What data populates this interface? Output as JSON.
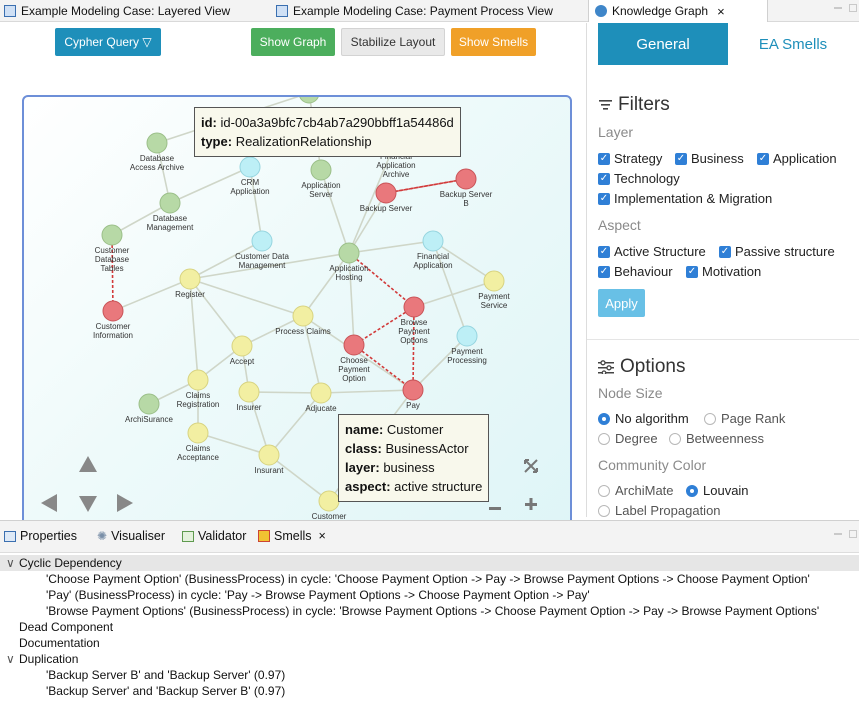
{
  "tabs": {
    "layered_view": "Example Modeling Case: Layered View",
    "payment_view": "Example Modeling Case: Payment Process View",
    "knowledge_graph": "Knowledge Graph",
    "close_glyph": "×"
  },
  "toolbar": {
    "cypher_query": "Cypher Query ▽",
    "show_graph": "Show Graph",
    "stabilize_layout": "Stabilize Layout",
    "show_smells": "Show Smells"
  },
  "colors": {
    "cypher": "#1e8fba",
    "show_graph": "#4cae5d",
    "stabilize": "#e9e9e9",
    "show_smells": "#f0a028",
    "general_tab": "#1e8fba",
    "apply": "#68c0e6",
    "node_green": "#b7d9a6",
    "node_cyan": "#bdeff6",
    "node_yellow": "#f2efa2",
    "node_red": "#e9787c"
  },
  "graph": {
    "tooltip_top": {
      "id_key": "id:",
      "id_value": "id-00a3a9bfc7cb4ab7a290bbff1a54486d",
      "type_key": "type:",
      "type_value": "RealizationRelationship"
    },
    "tooltip_bottom": {
      "name_key": "name:",
      "name_value": "Customer",
      "class_key": "class:",
      "class_value": "BusinessActor",
      "layer_key": "layer:",
      "layer_value": "business",
      "aspect_key": "aspect:",
      "aspect_value": "active structure"
    },
    "node_labels": {
      "database_access_archive": "Database\nAccess Archive",
      "crm_application": "CRM\nApplication",
      "application_server": "Application\nServer",
      "financial_application_archive": "Financial\nApplication\nArchive",
      "backup_server": "Backup Server",
      "backup_server_b": "Backup Server\nB",
      "database_management": "Database\nManagement",
      "customer_database_tables": "Customer\nDatabase\nTables",
      "customer_data_management": "Customer Data\nManagement",
      "financial_application": "Financial\nApplication",
      "application_hosting": "Application\nHosting",
      "register": "Register",
      "payment_service": "Payment\nService",
      "customer_information": "Customer\nInformation",
      "process_claims": "Process Claims",
      "browse_payment_options": "Browse\nPayment\nOptions",
      "accept": "Accept",
      "choose_payment_option": "Choose\nPayment\nOption",
      "payment_processing": "Payment\nProcessing",
      "claims_registration": "Claims\nRegistration",
      "archisurance": "ArchiSurance",
      "insurer": "Insurer",
      "adjucate": "Adjucate",
      "pay": "Pay",
      "claims_acceptance": "Claims\nAcceptance",
      "insurant": "Insurant",
      "customer": "Customer"
    },
    "nav_icons": [
      "up-arrow-icon",
      "left-arrow-icon",
      "down-arrow-icon",
      "right-arrow-icon",
      "fit-icon",
      "zoom-out-icon",
      "zoom-in-icon"
    ]
  },
  "right_panel": {
    "tab_general": "General",
    "tab_ea_smells": "EA Smells",
    "filters_title": "Filters",
    "layer_label": "Layer",
    "layers": [
      "Strategy",
      "Business",
      "Application",
      "Technology",
      "Implementation & Migration"
    ],
    "aspect_label": "Aspect",
    "aspects": [
      "Active Structure",
      "Passive structure",
      "Behaviour",
      "Motivation"
    ],
    "apply": "Apply",
    "options_title": "Options",
    "node_size_label": "Node Size",
    "node_size_options": [
      "No algorithm",
      "Page Rank",
      "Degree",
      "Betweenness"
    ],
    "node_size_selected": "No algorithm",
    "community_label": "Community Color",
    "community_options": [
      "ArchiMate",
      "Louvain",
      "Label Propagation"
    ],
    "community_selected": "Louvain"
  },
  "bottom_panel": {
    "tabs": [
      "Properties",
      "Visualiser",
      "Validator",
      "Smells"
    ],
    "close_glyph": "×",
    "tree": [
      {
        "text": "Cyclic Dependency",
        "level": 0,
        "expanded": true
      },
      {
        "text": "'Choose Payment Option' (BusinessProcess) in cycle: 'Choose Payment Option -> Pay -> Browse Payment Options -> Choose Payment Option'",
        "level": 1
      },
      {
        "text": "'Pay' (BusinessProcess) in cycle: 'Pay -> Browse Payment Options -> Choose Payment Option -> Pay'",
        "level": 1
      },
      {
        "text": "'Browse Payment Options' (BusinessProcess) in cycle: 'Browse Payment Options -> Choose Payment Option -> Pay -> Browse Payment Options'",
        "level": 1
      },
      {
        "text": "Dead Component",
        "level": 0
      },
      {
        "text": "Documentation",
        "level": 0
      },
      {
        "text": "Duplication",
        "level": 0,
        "expanded": true
      },
      {
        "text": "'Backup Server B' and 'Backup Server' (0.97)",
        "level": 1
      },
      {
        "text": "'Backup Server' and 'Backup Server B' (0.97)",
        "level": 1
      }
    ]
  }
}
